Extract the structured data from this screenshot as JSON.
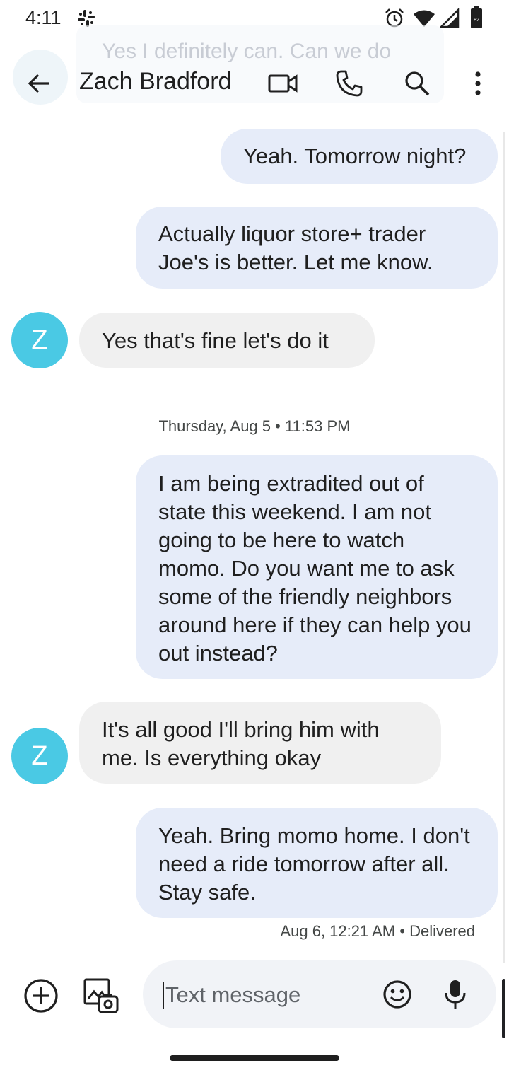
{
  "status_bar": {
    "time": "4:11",
    "icons": [
      "slack-icon",
      "alarm-icon",
      "wifi-icon",
      "signal-icon",
      "battery-icon"
    ],
    "battery_level": "82"
  },
  "preview": {
    "text": "Yes I definitely can. Can we do"
  },
  "header": {
    "contact_name": "Zach Bradford",
    "icons": [
      "back-arrow-icon",
      "video-call-icon",
      "phone-icon",
      "search-icon",
      "more-vert-icon"
    ]
  },
  "messages": [
    {
      "direction": "outgoing",
      "text": "Yeah. Tomorrow night?"
    },
    {
      "direction": "outgoing",
      "text": "Actually liquor store+ trader Joe's is better. Let me know."
    },
    {
      "direction": "incoming",
      "avatar_letter": "Z",
      "text": "Yes that's fine let's do it"
    },
    {
      "direction": "date",
      "text": "Thursday, Aug 5 • 11:53 PM"
    },
    {
      "direction": "outgoing",
      "text": "I am being extradited out of state this weekend. I am not going to be here to watch momo. Do you want me to ask some of the friendly neighbors around here if they can help you out instead?"
    },
    {
      "direction": "incoming",
      "avatar_letter": "Z",
      "text": "It's all good I'll bring him with me. Is everything okay"
    },
    {
      "direction": "outgoing",
      "text": "Yeah. Bring momo home. I don't need a ride tomorrow after all. Stay safe."
    }
  ],
  "delivery_status": "Aug 6, 12:21 AM • Delivered",
  "compose": {
    "placeholder": "Text message",
    "value": "",
    "icons": [
      "add-circle-icon",
      "gallery-icon",
      "emoji-icon",
      "microphone-icon"
    ]
  },
  "colors": {
    "outgoing_bubble": "#e6ecf9",
    "incoming_bubble": "#f0f0f0",
    "avatar": "#4ac9e4",
    "compose_bg": "#f1f3f7"
  }
}
